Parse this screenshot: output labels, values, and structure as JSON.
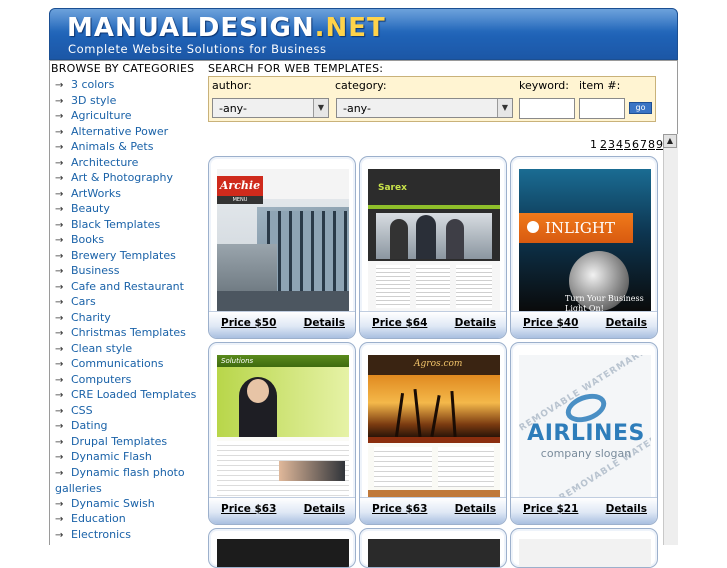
{
  "header": {
    "title_main": "MANUALDESIGN",
    "title_tld": ".NET",
    "slogan": "Complete Website Solutions for Business"
  },
  "sidebar": {
    "heading": "BROWSE BY CATEGORIES",
    "arrow": "→",
    "categories": [
      "3 colors",
      "3D style",
      "Agriculture",
      "Alternative Power",
      "Animals & Pets",
      "Architecture",
      "Art & Photography",
      "ArtWorks",
      "Beauty",
      "Black Templates",
      "Books",
      "Brewery Templates",
      "Business",
      "Cafe and Restaurant",
      "Cars",
      "Charity",
      "Christmas Templates",
      "Clean style",
      "Communications",
      "Computers",
      "CRE Loaded Templates",
      "CSS",
      "Dating",
      "Drupal Templates",
      "Dynamic Flash",
      "Dynamic flash photo galleries",
      "Dynamic Swish",
      "Education",
      "Electronics"
    ]
  },
  "search": {
    "heading": "SEARCH FOR WEB TEMPLATES:",
    "author_label": "author:",
    "author_value": "-any-",
    "category_label": "category:",
    "category_value": "-any-",
    "keyword_label": "keyword:",
    "item_label": "item #:",
    "go_label": "go"
  },
  "pager": {
    "current": "1",
    "pages": [
      "2",
      "3",
      "4",
      "5",
      "6",
      "7",
      "8",
      "9"
    ]
  },
  "templates": [
    {
      "price": "Price $50",
      "details": "Details",
      "brand": "Archie",
      "sub": "MENU"
    },
    {
      "price": "Price $64",
      "details": "Details",
      "brand": "Sarex"
    },
    {
      "price": "Price $40",
      "details": "Details",
      "brand": "INLIGHT",
      "caption": "Turn Your Business Light On!"
    },
    {
      "price": "Price $63",
      "details": "Details",
      "brand": "Solutions"
    },
    {
      "price": "Price $63",
      "details": "Details",
      "brand": "Agros.com"
    },
    {
      "price": "Price $21",
      "details": "Details",
      "brand": "AIRLINES",
      "sub": "company slogan",
      "watermark": "REMOVABLE WATERMARK"
    }
  ],
  "colors": {
    "header_blue": "#1f62b6",
    "link_blue": "#1a62a8",
    "search_bg": "#fff4d2",
    "tld_yellow": "#ffd34a"
  }
}
